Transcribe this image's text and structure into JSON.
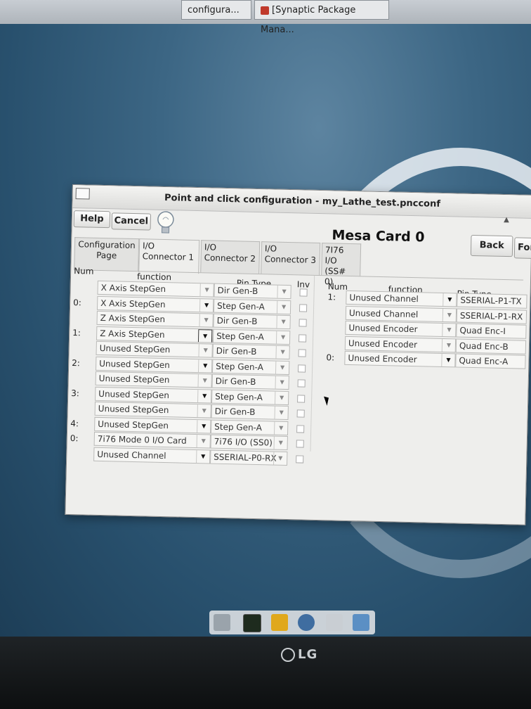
{
  "taskbar": {
    "items": [
      "configura...",
      "[Synaptic Package Mana..."
    ]
  },
  "window": {
    "title": "Point and click configuration - my_Lathe_test.pncconf",
    "help_label": "Help",
    "cancel_label": "Cancel",
    "back_label": "Back",
    "forward_label": "Forw",
    "heading": "Mesa Card 0"
  },
  "tabs": [
    {
      "label": "Configuration Page"
    },
    {
      "label": "I/O Connector 1"
    },
    {
      "label": "I/O Connector 2"
    },
    {
      "label": "I/O Connector 3"
    },
    {
      "label": "7I76 I/O (SS# 0)"
    }
  ],
  "left_table": {
    "headers": {
      "num": "Num",
      "function": "function",
      "pin_type": "Pin Type",
      "inv": "Inv"
    },
    "rows": [
      {
        "num": "",
        "function": "X Axis StepGen",
        "pin": "Dir Gen-B"
      },
      {
        "num": "0:",
        "function": "X Axis StepGen",
        "pin": "Step Gen-A"
      },
      {
        "num": "",
        "function": "Z Axis StepGen",
        "pin": "Dir Gen-B"
      },
      {
        "num": "1:",
        "function": "Z Axis StepGen",
        "pin": "Step Gen-A"
      },
      {
        "num": "",
        "function": "Unused StepGen",
        "pin": "Dir Gen-B"
      },
      {
        "num": "2:",
        "function": "Unused StepGen",
        "pin": "Step Gen-A"
      },
      {
        "num": "",
        "function": "Unused StepGen",
        "pin": "Dir Gen-B"
      },
      {
        "num": "3:",
        "function": "Unused StepGen",
        "pin": "Step Gen-A"
      },
      {
        "num": "",
        "function": "Unused StepGen",
        "pin": "Dir Gen-B"
      },
      {
        "num": "4:",
        "function": "Unused StepGen",
        "pin": "Step Gen-A"
      },
      {
        "num": "0:",
        "function": "7i76 Mode 0 I/O Card",
        "pin": "7i76 I/O (SS0)"
      },
      {
        "num": "",
        "function": "Unused Channel",
        "pin": "SSERIAL-P0-RX"
      }
    ]
  },
  "right_table": {
    "headers": {
      "num": "Num",
      "function": "function",
      "pin_type": "Pin Type"
    },
    "rows": [
      {
        "num": "1:",
        "function": "Unused Channel",
        "pin": "SSERIAL-P1-TX"
      },
      {
        "num": "",
        "function": "Unused Channel",
        "pin": "SSERIAL-P1-RX"
      },
      {
        "num": "",
        "function": "Unused Encoder",
        "pin": "Quad Enc-I"
      },
      {
        "num": "",
        "function": "Unused Encoder",
        "pin": "Quad Enc-B"
      },
      {
        "num": "0:",
        "function": "Unused Encoder",
        "pin": "Quad Enc-A"
      }
    ]
  },
  "monitor": {
    "brand": "LG"
  }
}
